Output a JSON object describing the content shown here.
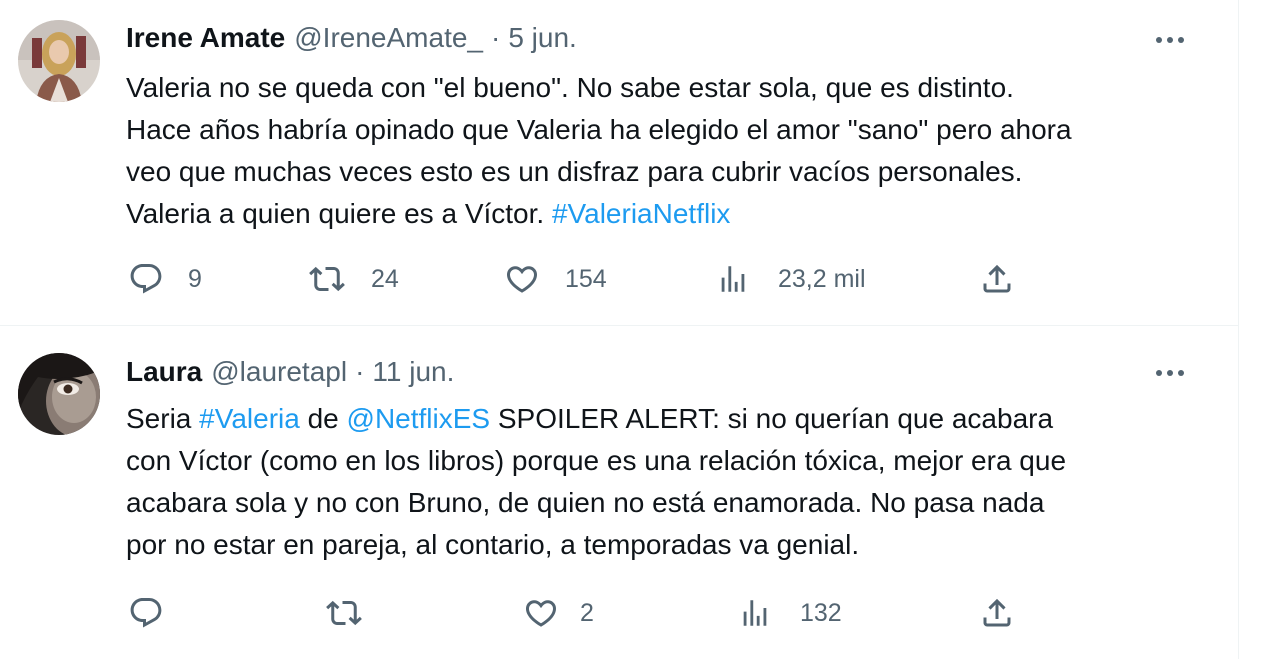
{
  "tweets": [
    {
      "name": "Irene Amate",
      "handle": "@IreneAmate_",
      "sep": "·",
      "date": "5 jun.",
      "lines": [
        [
          {
            "t": "Valeria no se queda con \"el bueno\". No sabe estar sola, que es distinto."
          }
        ],
        [
          {
            "t": "Hace años habría opinado que Valeria ha elegido el amor \"sano\" pero ahora"
          }
        ],
        [
          {
            "t": "veo que muchas veces esto es un disfraz para cubrir vacíos personales."
          }
        ],
        [
          {
            "t": "Valeria a quien quiere es a Víctor. "
          },
          {
            "t": "#ValeriaNetflix",
            "link": true
          }
        ]
      ],
      "replies": "9",
      "retweets": "24",
      "likes": "154",
      "views": "23,2 mil"
    },
    {
      "name": "Laura",
      "handle": "@lauretapl",
      "sep": "·",
      "date": "11 jun.",
      "lines": [
        [
          {
            "t": "Seria "
          },
          {
            "t": "#Valeria",
            "link": true
          },
          {
            "t": " de "
          },
          {
            "t": "@NetflixES",
            "link": true
          },
          {
            "t": " SPOILER ALERT: si no querían que acabara"
          }
        ],
        [
          {
            "t": "con Víctor (como en los libros) porque es una relación tóxica, mejor era que"
          }
        ],
        [
          {
            "t": "acabara sola y no con Bruno, de quien no está enamorada. No pasa nada"
          }
        ],
        [
          {
            "t": "por no estar en pareja, al contario, a temporadas va genial."
          }
        ]
      ],
      "replies": "",
      "retweets": "",
      "likes": "2",
      "views": "132"
    }
  ],
  "colors": {
    "text": "#0f1419",
    "secondary": "#536471",
    "link": "#1d9bf0",
    "divider": "#eff3f4"
  },
  "icons": [
    "reply-icon",
    "retweet-icon",
    "like-icon",
    "views-icon",
    "share-icon",
    "more-icon"
  ]
}
